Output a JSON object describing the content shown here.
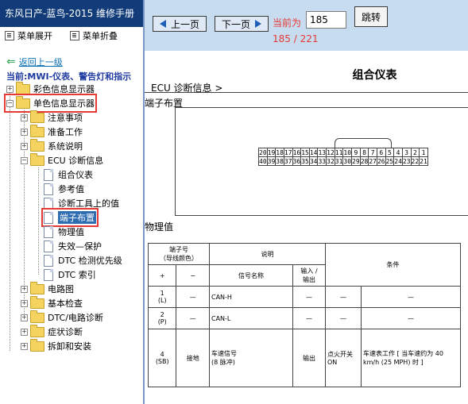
{
  "left_panel": {
    "title": "东风日产-蓝鸟-2015 维修手册",
    "toolbar": {
      "expand": "菜单展开",
      "collapse": "菜单折叠"
    },
    "back": "返回上一级",
    "current": "当前:MWI-仪表、警告灯和指示",
    "tree": [
      {
        "label": "彩色信息显示器"
      },
      {
        "label": "单色信息显示器"
      },
      {
        "label": "注意事项"
      },
      {
        "label": "准备工作"
      },
      {
        "label": "系统说明"
      },
      {
        "label": "ECU 诊断信息"
      },
      {
        "label": "组合仪表"
      },
      {
        "label": "参考值"
      },
      {
        "label": "诊断工具上的值"
      },
      {
        "label": "端子布置"
      },
      {
        "label": "物理值"
      },
      {
        "label": "失效—保护"
      },
      {
        "label": "DTC 检测优先级"
      },
      {
        "label": "DTC 索引"
      },
      {
        "label": "电路图"
      },
      {
        "label": "基本检查"
      },
      {
        "label": "DTC/电路诊断"
      },
      {
        "label": "症状诊断"
      },
      {
        "label": "拆卸和安装"
      }
    ]
  },
  "viewer": {
    "prev": "上一页",
    "next": "下一页",
    "current_label": "当前为",
    "page_value": "185",
    "go": "跳转",
    "page_count": "185 / 221"
  },
  "doc": {
    "title": "组合仪表",
    "breadcrumb": "ECU 诊断信息 >",
    "section1": "端子布置",
    "pins_top": [
      "20",
      "19",
      "18",
      "17",
      "16",
      "15",
      "14",
      "13",
      "12",
      "11",
      "10",
      "9",
      "8",
      "7",
      "6",
      "5",
      "4",
      "3",
      "2",
      "1"
    ],
    "pins_bottom": [
      "40",
      "39",
      "38",
      "37",
      "36",
      "35",
      "34",
      "33",
      "32",
      "31",
      "30",
      "29",
      "28",
      "27",
      "26",
      "25",
      "24",
      "23",
      "22",
      "21"
    ],
    "section2": "物理值",
    "table": {
      "h_terminal": "端子号\n（导线颜色）",
      "h_desc": "说明",
      "h_cond": "条件",
      "h_plus": "+",
      "h_minus": "−",
      "h_signal": "信号名称",
      "h_io": "输入 /\n输出",
      "rows": [
        {
          "term": "1\n(L)",
          "minus": "—",
          "signal": "CAN-H",
          "io": "—",
          "c1": "—",
          "c2": "—"
        },
        {
          "term": "2\n(P)",
          "minus": "—",
          "signal": "CAN-L",
          "io": "—",
          "c1": "—",
          "c2": "—"
        },
        {
          "term": "4\n(SB)",
          "minus": "接地",
          "signal": "车速信号\n(8 脉冲)",
          "io": "输出",
          "c1": "点火开关\nON",
          "c2": "车速表工作 [ 当车速约为 40 km/h (25 MPH) 时 ]"
        }
      ]
    }
  }
}
